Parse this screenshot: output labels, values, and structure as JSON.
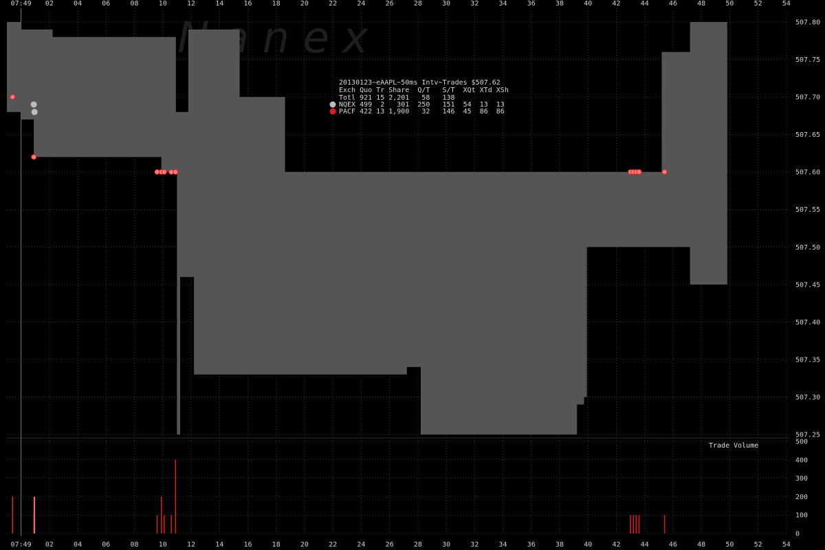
{
  "chart_data": {
    "type": "area",
    "title": "20130123~eAAPL~50ms Intv~Trades $507.62",
    "watermark": "N a n e x",
    "x_ticks": [
      "07:49",
      "02",
      "04",
      "06",
      "08",
      "10",
      "12",
      "14",
      "16",
      "18",
      "20",
      "22",
      "24",
      "26",
      "28",
      "30",
      "32",
      "34",
      "36",
      "38",
      "40",
      "42",
      "44",
      "46",
      "48",
      "50",
      "52",
      "54"
    ],
    "x_range_seconds": [
      -1,
      54.2
    ],
    "price_axis": {
      "ticks": [
        "507.25",
        "507.30",
        "507.35",
        "507.40",
        "507.45",
        "507.50",
        "507.55",
        "507.60",
        "507.65",
        "507.70",
        "507.75",
        "507.80"
      ],
      "range": [
        507.25,
        507.8
      ]
    },
    "volume_axis": {
      "label": "Trade Volume",
      "ticks": [
        "0",
        "100",
        "200",
        "300",
        "400",
        "500"
      ],
      "range": [
        0,
        500
      ]
    },
    "table": {
      "header": "Exch Quo Tr Share  Q/T   S/T  XQt XTd XSh",
      "rows": [
        {
          "text": "Totl 921 15 2,201   58   138",
          "marker": ""
        },
        {
          "text": "NQEX 499  2   301  250   151  54  13  13",
          "marker": "#bdbdbd"
        },
        {
          "text": "PACF 422 13 1,900   32   146  45  86  86",
          "marker": "#e02020"
        }
      ]
    },
    "colors": {
      "background": "#000000",
      "spread": "#555555",
      "grid": "#3a3a3a",
      "nqex": "#bdbdbd",
      "pacf": "#e02020",
      "pacf_marker": "#f08080"
    },
    "ask_steps": [
      [
        -1,
        507.8
      ],
      [
        0,
        507.79
      ],
      [
        2.2,
        507.78
      ],
      [
        10.9,
        507.68
      ],
      [
        11.8,
        507.79
      ],
      [
        15.4,
        507.7
      ],
      [
        18.6,
        507.6
      ],
      [
        45.2,
        507.76
      ],
      [
        47.2,
        507.8
      ],
      [
        49.8,
        507.8
      ]
    ],
    "bid_steps": [
      [
        -1,
        507.68
      ],
      [
        0,
        507.67
      ],
      [
        0.9,
        507.62
      ],
      [
        9.9,
        507.6
      ],
      [
        11.0,
        507.25
      ],
      [
        11.2,
        507.46
      ],
      [
        12.2,
        507.33
      ],
      [
        27.2,
        507.34
      ],
      [
        28.2,
        507.25
      ],
      [
        39.2,
        507.29
      ],
      [
        39.7,
        507.3
      ],
      [
        39.9,
        507.5
      ],
      [
        47.2,
        507.45
      ],
      [
        49.8,
        507.45
      ]
    ],
    "trades": [
      {
        "t": -0.6,
        "price": 507.7,
        "exch": "PACF",
        "volume": 200
      },
      {
        "t": 0.9,
        "price": 507.69,
        "exch": "NQEX",
        "volume": 100
      },
      {
        "t": 0.95,
        "price": 507.68,
        "exch": "NQEX",
        "volume": 200
      },
      {
        "t": 0.9,
        "price": 507.62,
        "exch": "PACF",
        "volume": 200
      },
      {
        "t": 9.6,
        "price": 507.6,
        "exch": "PACF",
        "volume": 100
      },
      {
        "t": 9.9,
        "price": 507.6,
        "exch": "PACF",
        "volume": 200
      },
      {
        "t": 10.1,
        "price": 507.6,
        "exch": "PACF",
        "volume": 100
      },
      {
        "t": 10.6,
        "price": 507.6,
        "exch": "PACF",
        "volume": 100
      },
      {
        "t": 10.9,
        "price": 507.6,
        "exch": "PACF",
        "volume": 400
      },
      {
        "t": 43.0,
        "price": 507.6,
        "exch": "PACF",
        "volume": 100
      },
      {
        "t": 43.2,
        "price": 507.6,
        "exch": "PACF",
        "volume": 100
      },
      {
        "t": 43.4,
        "price": 507.6,
        "exch": "PACF",
        "volume": 100
      },
      {
        "t": 43.6,
        "price": 507.6,
        "exch": "PACF",
        "volume": 100
      },
      {
        "t": 45.4,
        "price": 507.6,
        "exch": "PACF",
        "volume": 100
      }
    ]
  }
}
